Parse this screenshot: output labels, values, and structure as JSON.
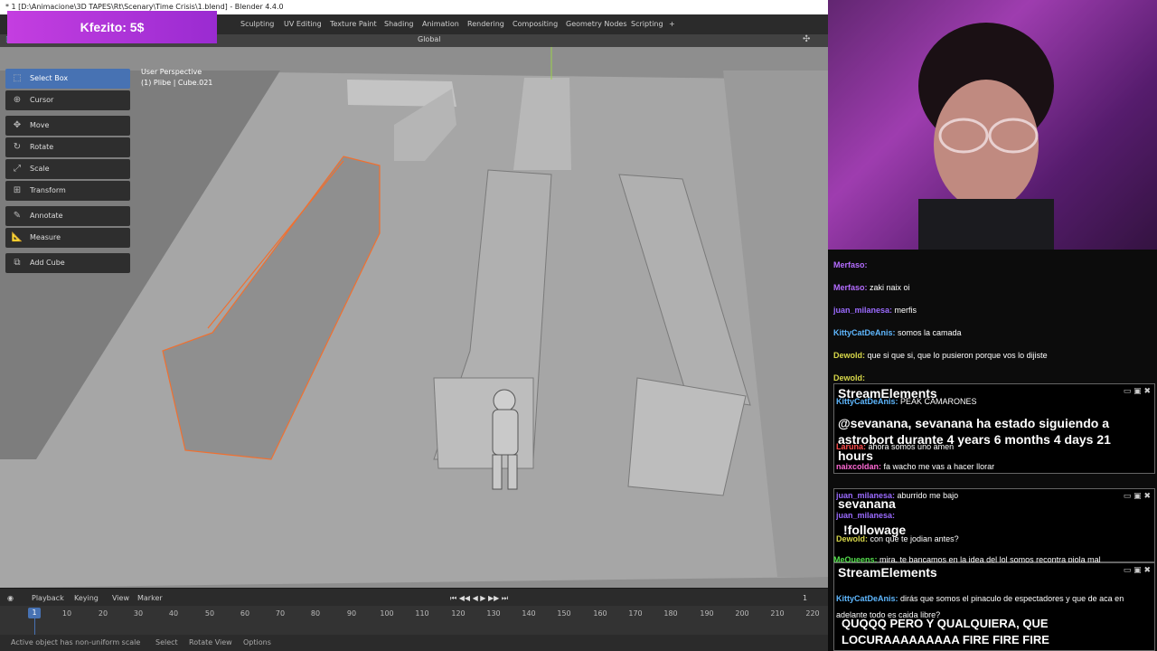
{
  "window": {
    "title": "* 1 [D:\\Animacione\\3D TAPES\\Rt\\Scenary\\Time Crisis\\1.blend] - Blender 4.4.0"
  },
  "donation": {
    "text": "Kfezito: 5$"
  },
  "workspaces": [
    "Sculpting",
    "UV Editing",
    "Texture Paint",
    "Shading",
    "Animation",
    "Rendering",
    "Compositing",
    "Geometry Nodes",
    "Scripting",
    "+"
  ],
  "viewport_header": {
    "orientation": "Global"
  },
  "tools": [
    {
      "label": "Select Box",
      "icon": "select-box-icon",
      "active": true
    },
    {
      "label": "Cursor",
      "icon": "cursor-icon"
    },
    {
      "label": "Move",
      "icon": "move-icon"
    },
    {
      "label": "Rotate",
      "icon": "rotate-icon"
    },
    {
      "label": "Scale",
      "icon": "scale-icon"
    },
    {
      "label": "Transform",
      "icon": "transform-icon"
    },
    {
      "label": "Annotate",
      "icon": "annotate-icon"
    },
    {
      "label": "Measure",
      "icon": "measure-icon"
    },
    {
      "label": "Add Cube",
      "icon": "add-cube-icon"
    }
  ],
  "viewport_info": {
    "line1": "User Perspective",
    "line2": "(1) Plibe | Cube.021"
  },
  "timeline": {
    "menus": [
      "Playback",
      "Keying",
      "View",
      "Marker"
    ],
    "current_frame": "1",
    "frame_display": "1",
    "ticks": [
      "10",
      "20",
      "30",
      "40",
      "50",
      "60",
      "70",
      "80",
      "90",
      "100",
      "110",
      "120",
      "130",
      "140",
      "150",
      "160",
      "170",
      "180",
      "190",
      "200",
      "210",
      "220"
    ]
  },
  "statusbar": {
    "message": "Active object has non-uniform scale",
    "hints": [
      "Select",
      "Rotate View",
      "Options"
    ]
  },
  "chat": {
    "messages": [
      {
        "user": "Merfaso:",
        "text": "",
        "color": "#b46cff"
      },
      {
        "user": "Merfaso:",
        "text": "zaki naix oi",
        "color": "#b46cff"
      },
      {
        "user": "juan_milanesa:",
        "text": "merfis",
        "color": "#9b6bff"
      },
      {
        "user": "KittyCatDeAnis:",
        "text": "somos la camada",
        "color": "#5fb8ff"
      },
      {
        "user": "Dewold:",
        "text": "que si que si, que lo pusieron porque vos lo dijiste",
        "color": "#d8d84a"
      },
      {
        "user": "Dewold:",
        "text": "",
        "color": "#d8d84a"
      },
      {
        "user": "KittyCatDeAnis:",
        "text": "PEAK CAMARONES",
        "color": "#5fb8ff"
      },
      {
        "user": "Laruna:",
        "text": "ahora somos uno amen",
        "color": "#ff4d4d"
      },
      {
        "user": "naixcoldan:",
        "text": "fa wacho me vas a hacer llorar",
        "color": "#ff6ad5"
      },
      {
        "user": "juan_milanesa:",
        "text": "aburrido me bajo",
        "color": "#9b6bff"
      },
      {
        "user": "juan_milanesa:",
        "text": "",
        "color": "#9b6bff"
      },
      {
        "user": "Dewold:",
        "text": "con que te jodian antes?",
        "color": "#d8d84a"
      },
      {
        "user": "MeQueens:",
        "text": "mira, te bancamos en la idea del lol somos recontra piola mal",
        "color": "#55e04d"
      },
      {
        "user": "KittyCatDeAnis:",
        "text": "dirás que somos el pinaculo de espectadores y que de aca en",
        "color": "#5fb8ff"
      },
      {
        "user": "",
        "text": "adelante todo es caida libre?",
        "color": "#ffffff"
      }
    ],
    "alerts": [
      {
        "title": "StreamElements",
        "body": "@sevanana, sevanana ha estado siguiendo a astrobort durante 4 years 6 months 4 days 21 hours"
      },
      {
        "title": "sevanana",
        "body": "!followage"
      },
      {
        "title": "StreamElements",
        "body": "QUQQQ PERO Y QUALQUIERA, QUE LOCURAAAAAAAAA FIRE FIRE FIRE"
      }
    ]
  }
}
